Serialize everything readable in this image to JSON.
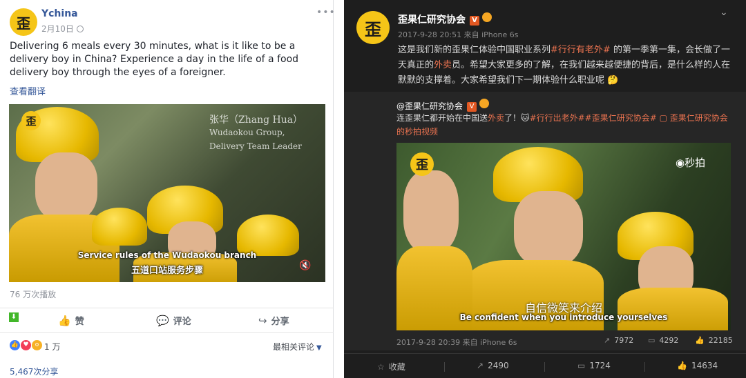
{
  "facebook": {
    "page_name": "Ychina",
    "date": "2月10日",
    "post_text": "Delivering 6 meals every 30 minutes, what is it like to be a delivery boy in China? Experience a day in the life of a food delivery boy through the eyes of a foreigner.",
    "see_translation": "查看翻译",
    "video": {
      "logo_char": "歪",
      "caption_name": "张华（Zhang Hua）",
      "caption_line2": "Wudaokou Group,",
      "caption_line3": "Delivery Team Leader",
      "subtitle_en": "Service rules of the Wudaokou branch",
      "subtitle_zh": "五道口站服务步骤"
    },
    "views": "76 万次播放",
    "actions": {
      "like": "赞",
      "comment": "评论",
      "share": "分享"
    },
    "reaction_count": "1 万",
    "most_relevant": "最相关评论",
    "share_count": "5,467次分享"
  },
  "weibo": {
    "account_name": "歪果仁研究协会",
    "avatar_char": "歪",
    "meta": "2017-9-28 20:51 来自 iPhone 6s",
    "post_text_1": "这是我们新的歪果仁体验中国职业系列",
    "post_tag": "#行行有老外#",
    "post_text_2": " 的第一季第一集，会长做了一天真正的",
    "post_hl": "外卖",
    "post_text_3": "员。希望大家更多的了解，在我们越来越便捷的背后，是什么样的人在默默的支撑着。大家希望我们下一期体验什么职业呢",
    "repost": {
      "name": "@歪果仁研究协会",
      "text_1": "连歪果仁都开始在中国送",
      "text_hl": "外卖",
      "text_2": "了！",
      "tags": "#行行出老外##歪果仁研究协会# ▢ 歪果仁研究协会的秒拍视频",
      "video": {
        "logo_char": "歪",
        "miaopai": "秒拍",
        "subtitle_zh": "自信微笑来介绍",
        "subtitle_en": "Be confident when you introduce yourselves"
      },
      "meta": "2017-9-28 20:39 来自 iPhone 6s",
      "reposts": "7972",
      "comments": "4292",
      "likes": "22185"
    },
    "bar": {
      "favorite": "收藏",
      "reposts": "2490",
      "comments": "1724",
      "likes": "14634"
    }
  }
}
